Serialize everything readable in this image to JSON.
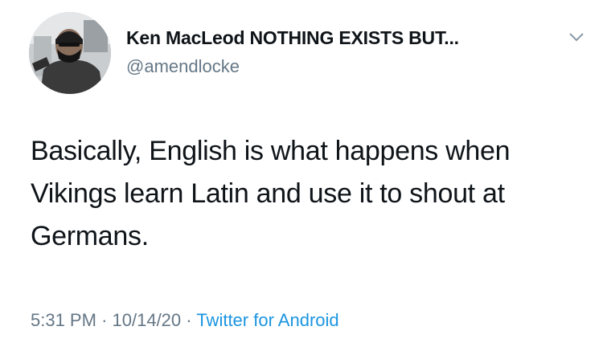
{
  "tweet": {
    "display_name": "Ken MacLeod NOTHING EXISTS BUT...",
    "handle": "@amendlocke",
    "text": "Basically, English is what happens when Vikings learn Latin and use it to shout at Germans.",
    "time": "5:31 PM",
    "separator": "·",
    "date": "10/14/20",
    "source": "Twitter for Android"
  },
  "colors": {
    "text": "#0f1419",
    "muted": "#657786",
    "link": "#1b95e0"
  },
  "icons": {
    "more": "chevron-down-icon",
    "avatar": "avatar"
  }
}
